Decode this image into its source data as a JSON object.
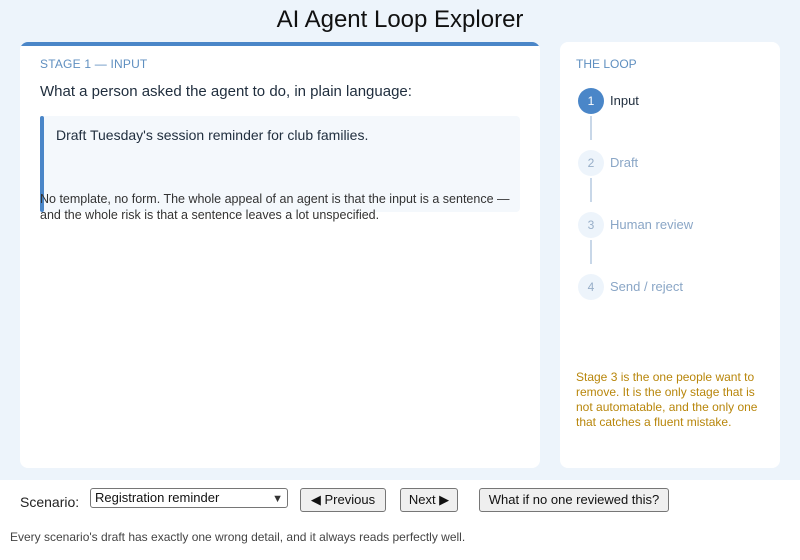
{
  "app": {
    "title": "AI Agent Loop Explorer"
  },
  "main": {
    "stage_label": "STAGE 1 — INPUT",
    "question": "What a person asked the agent to do, in plain language:",
    "input_text": "Draft Tuesday's session reminder for club families.",
    "note": "No template, no form. The whole appeal of an agent is that the input is a sentence — and the whole risk is that a sentence leaves a lot unspecified."
  },
  "loop": {
    "title": "THE LOOP",
    "steps": [
      {
        "number": "1",
        "label": "Input",
        "active": true
      },
      {
        "number": "2",
        "label": "Draft",
        "active": false
      },
      {
        "number": "3",
        "label": "Human review",
        "active": false
      },
      {
        "number": "4",
        "label": "Send / reject",
        "active": false
      }
    ],
    "note": "Stage 3 is the one people want to remove. It is the only stage that is not automatable, and the only one that catches a fluent mistake."
  },
  "controls": {
    "scenario_label": "Scenario:",
    "scenario_value": "Registration reminder",
    "prev_label": "◀ Previous",
    "next_label": "Next ▶",
    "whatif_label": "What if no one reviewed this?"
  },
  "footer": {
    "note": "Every scenario's draft has exactly one wrong detail, and it always reads perfectly well."
  },
  "colors": {
    "accent": "#4a86c8",
    "warning_text": "#b8860b",
    "panel_bg": "#edf4fb"
  }
}
